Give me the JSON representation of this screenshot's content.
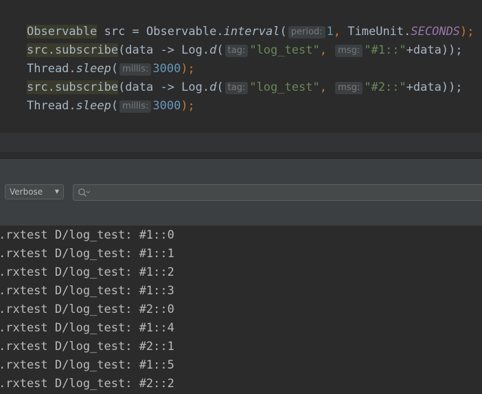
{
  "editor": {
    "lines": [
      [
        {
          "t": "Observable",
          "c": "plain hl"
        },
        {
          "t": " src = Observable.",
          "c": "plain"
        },
        {
          "t": "interval",
          "c": "plain italic"
        },
        {
          "t": "(",
          "c": "plain"
        },
        {
          "t": "period:",
          "c": "hint"
        },
        {
          "t": "1",
          "c": "num"
        },
        {
          "t": ", ",
          "c": "kw"
        },
        {
          "t": "TimeUnit.",
          "c": "plain"
        },
        {
          "t": "SECONDS",
          "c": "const"
        },
        {
          "t": ");",
          "c": "kw"
        }
      ],
      [
        {
          "t": "src.subscribe",
          "c": "plain hl"
        },
        {
          "t": "(data -> Log.",
          "c": "plain"
        },
        {
          "t": "d",
          "c": "plain italic"
        },
        {
          "t": "(",
          "c": "plain"
        },
        {
          "t": "tag:",
          "c": "hint"
        },
        {
          "t": "\"log_test\"",
          "c": "str"
        },
        {
          "t": ", ",
          "c": "kw"
        },
        {
          "t": "msg:",
          "c": "hint"
        },
        {
          "t": "\"#1::\"",
          "c": "str"
        },
        {
          "t": "+data));",
          "c": "plain"
        }
      ],
      [
        {
          "t": "Thread.",
          "c": "plain"
        },
        {
          "t": "sleep",
          "c": "plain italic"
        },
        {
          "t": "(",
          "c": "plain"
        },
        {
          "t": "millis:",
          "c": "hint"
        },
        {
          "t": "3000",
          "c": "num"
        },
        {
          "t": ");",
          "c": "kw"
        }
      ],
      [
        {
          "t": "src.subscribe",
          "c": "plain hl"
        },
        {
          "t": "(data -> Log.",
          "c": "plain"
        },
        {
          "t": "d",
          "c": "plain italic"
        },
        {
          "t": "(",
          "c": "plain"
        },
        {
          "t": "tag:",
          "c": "hint"
        },
        {
          "t": "\"log_test\"",
          "c": "str"
        },
        {
          "t": ", ",
          "c": "kw"
        },
        {
          "t": "msg:",
          "c": "hint"
        },
        {
          "t": "\"#2::\"",
          "c": "str"
        },
        {
          "t": "+data));",
          "c": "plain"
        }
      ],
      [
        {
          "t": "Thread.",
          "c": "plain"
        },
        {
          "t": "sleep",
          "c": "plain italic"
        },
        {
          "t": "(",
          "c": "plain"
        },
        {
          "t": "millis:",
          "c": "hint"
        },
        {
          "t": "3000",
          "c": "num"
        },
        {
          "t": ");",
          "c": "kw"
        }
      ]
    ]
  },
  "logcat": {
    "level": "Verbose",
    "search": {
      "value": "",
      "placeholder": ""
    },
    "rows": [
      ".rxtest D/log_test: #1::0",
      ".rxtest D/log_test: #1::1",
      ".rxtest D/log_test: #1::2",
      ".rxtest D/log_test: #1::3",
      ".rxtest D/log_test: #2::0",
      ".rxtest D/log_test: #1::4",
      ".rxtest D/log_test: #2::1",
      ".rxtest D/log_test: #1::5",
      ".rxtest D/log_test: #2::2"
    ]
  },
  "icons": {
    "search": "search-icon",
    "dropdown": "chevron-down-icon"
  },
  "colors": {
    "background": "#2b2b2b",
    "panel": "#3c3f41",
    "number": "#6897bb",
    "string": "#6a8759",
    "keyword": "#cc7832",
    "constant": "#9876aa",
    "highlight": "#3b3b2c",
    "log_text": "#bbbbbb"
  }
}
